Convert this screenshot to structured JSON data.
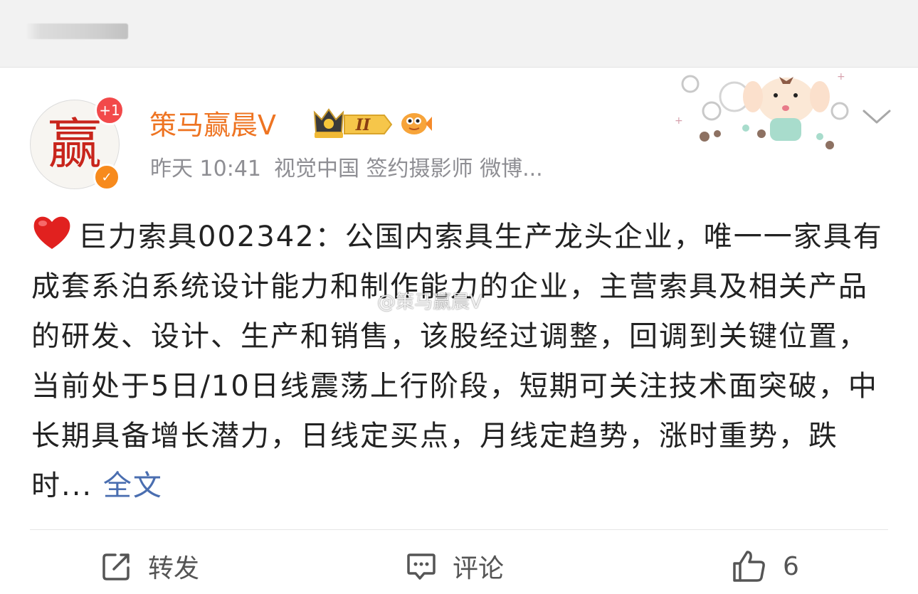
{
  "post": {
    "author": {
      "name": "策马赢晨V",
      "avatar_text": "赢",
      "notification_badge": "+1",
      "level_badge": "II"
    },
    "meta": {
      "time": "昨天 10:41",
      "source": "视觉中国 签约摄影师 微博..."
    },
    "text": "巨力索具002342：公国内索具生产龙头企业，唯一一家具有成套系泊系统设计能力和制作能力的企业，主营索具及相关产品的研发、设计、生产和销售，该股经过调整，回调到关键位置，当前处于5日/10日线震荡上行阶段，短期可关注技术面突破，中长期具备增长潜力，日线定买点，月线定趋势，涨时重势，跌时...",
    "more_link": " 全文",
    "watermark": "@策马赢晨V",
    "actions": {
      "repost_label": "转发",
      "comment_label": "评论",
      "like_count": "6"
    }
  },
  "colors": {
    "username": "#ee7422",
    "link": "#4a6eb0",
    "meta": "#8e8e93",
    "badge_red": "#f2494a",
    "verify_orange": "#f78a1c"
  },
  "icons": [
    "heart-emoji-icon",
    "crown-badge-icon",
    "fish-emoji-icon",
    "sticker-decoration",
    "chevron-down-icon",
    "repost-icon",
    "comment-icon",
    "like-icon"
  ]
}
